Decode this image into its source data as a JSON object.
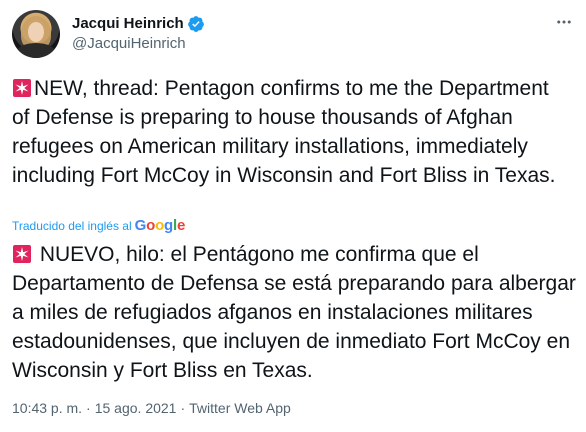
{
  "author": {
    "display_name": "Jacqui Heinrich",
    "handle": "@JacquiHeinrich",
    "verified": true
  },
  "tweet": {
    "emoji": "🚨",
    "text_original": "NEW, thread: Pentagon confirms to me the Department of Defense is preparing to house thousands of Afghan refugees on American military installations, immediately including Fort McCoy in Wisconsin and Fort Bliss in Texas.",
    "translated_label": "Traducido del inglés al",
    "translator": [
      "G",
      "o",
      "o",
      "g",
      "l",
      "e"
    ],
    "text_translated": " NUEVO, hilo: el Pentágono me confirma que el Departamento de Defensa se está preparando para albergar a miles de refugiados afganos en instalaciones militares estadounidenses, que incluyen de inmediato Fort McCoy en Wisconsin y Fort Bliss en Texas."
  },
  "meta": {
    "time": "10:43 p. m.",
    "sep1": "·",
    "date": "15 ago. 2021",
    "sep2": "·",
    "source": "Twitter Web App"
  },
  "colors": {
    "text": "#0f1419",
    "secondary": "#536471",
    "link": "#1d9bf0",
    "verified": "#1d9bf0",
    "siren": "#e0245e"
  },
  "icons": {
    "verified": "verified-badge-icon",
    "more": "more-options-icon",
    "siren": "rotating-light-emoji"
  }
}
